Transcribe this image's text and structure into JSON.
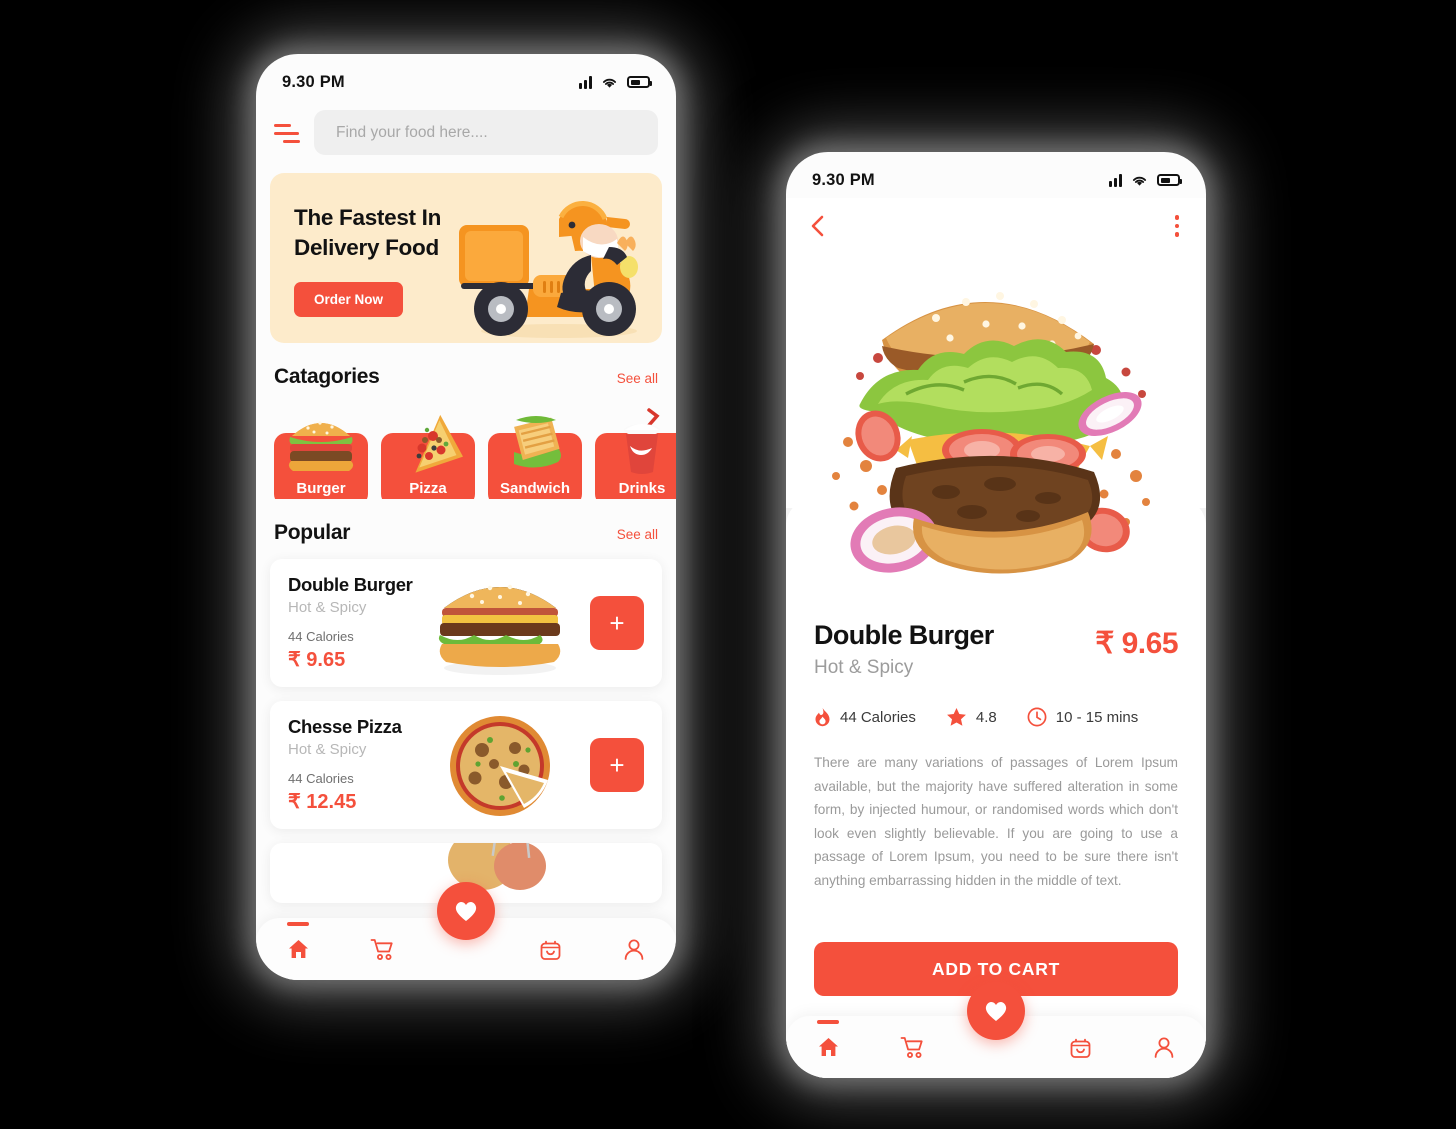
{
  "accent": "#F4503C",
  "banner_bg": "#FDEBCB",
  "phone1": {
    "status": {
      "time": "9.30 PM",
      "signal_icon": "signal-bars-icon",
      "wifi_icon": "wifi-icon",
      "battery_icon": "battery-icon"
    },
    "menu_icon": "hamburger-menu-icon",
    "search": {
      "placeholder": "Find your food here....",
      "value": ""
    },
    "banner": {
      "line1": "The Fastest In",
      "line2": "Delivery Food",
      "cta": "Order Now",
      "illustration": "delivery-scooter-illustration"
    },
    "categories_section": {
      "title": "Catagories",
      "see_all": "See all"
    },
    "categories": [
      {
        "label": "Burger",
        "icon": "burger-illustration"
      },
      {
        "label": "Pizza",
        "icon": "pizza-slice-illustration"
      },
      {
        "label": "Sandwich",
        "icon": "sandwich-illustration"
      },
      {
        "label": "Drinks",
        "icon": "soda-cup-illustration"
      }
    ],
    "popular_section": {
      "title": "Popular",
      "see_all": "See all"
    },
    "popular": [
      {
        "name": "Double Burger",
        "subtitle": "Hot & Spicy",
        "calories": "44 Calories",
        "price": "₹ 9.65",
        "add_label": "+",
        "image": "double-burger-photo"
      },
      {
        "name": "Chesse Pizza",
        "subtitle": "Hot & Spicy",
        "calories": "44 Calories",
        "price": "₹ 12.45",
        "add_label": "+",
        "image": "cheese-pizza-photo"
      }
    ],
    "nav": [
      {
        "name": "home",
        "icon": "home-icon",
        "active": true
      },
      {
        "name": "cart",
        "icon": "shopping-cart-icon",
        "active": false
      },
      {
        "name": "bag",
        "icon": "shopping-bag-icon",
        "active": false
      },
      {
        "name": "profile",
        "icon": "person-icon",
        "active": false
      }
    ],
    "fab_icon": "heart-icon"
  },
  "phone2": {
    "status": {
      "time": "9.30 PM",
      "signal_icon": "signal-bars-icon",
      "wifi_icon": "wifi-icon",
      "battery_icon": "battery-icon"
    },
    "back_icon": "back-chevron-icon",
    "more_icon": "more-vertical-icon",
    "hero_image": "exploded-double-burger-photo",
    "product": {
      "name": "Double Burger",
      "subtitle": "Hot & Spicy",
      "price": "₹ 9.65",
      "calories": "44 Calories",
      "rating": "4.8",
      "time": "10 - 15 mins",
      "calories_icon": "flame-icon",
      "rating_icon": "star-icon",
      "time_icon": "clock-icon",
      "description": "There are many variations of passages of Lorem Ipsum available, but the majority have suffered alteration in some form, by injected humour, or randomised words which don't look even slightly believable.  If you are going to use a passage of Lorem Ipsum, you need to be sure there isn't anything embarrassing hidden in the middle of text."
    },
    "add_to_cart": "ADD TO CART",
    "nav": [
      {
        "name": "home",
        "icon": "home-icon",
        "active": true
      },
      {
        "name": "cart",
        "icon": "shopping-cart-icon",
        "active": false
      },
      {
        "name": "bag",
        "icon": "shopping-bag-icon",
        "active": false
      },
      {
        "name": "profile",
        "icon": "person-icon",
        "active": false
      }
    ],
    "fab_icon": "heart-icon"
  }
}
